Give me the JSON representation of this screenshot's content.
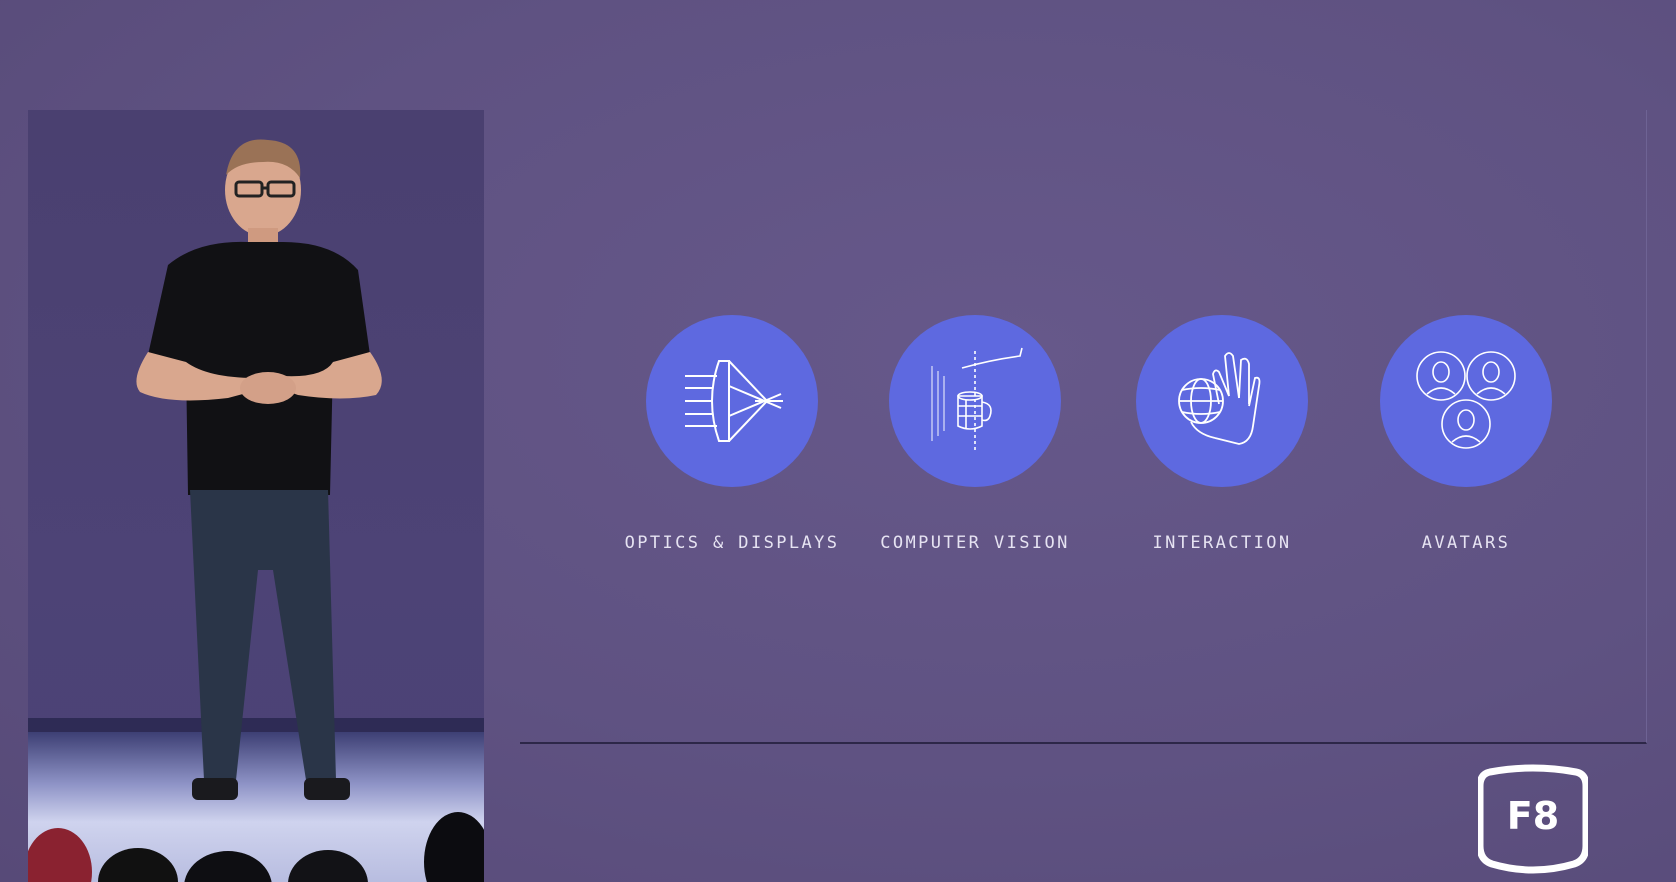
{
  "slide": {
    "features": [
      {
        "label": "OPTICS & DISPLAYS",
        "icon": "lens-optics-icon"
      },
      {
        "label": "COMPUTER VISION",
        "icon": "mug-scan-icon"
      },
      {
        "label": "INTERACTION",
        "icon": "hand-globe-icon"
      },
      {
        "label": "AVATARS",
        "icon": "people-avatars-icon"
      }
    ]
  },
  "badge": {
    "text": "F8"
  },
  "colors": {
    "background": "#5f5282",
    "circle": "#5e69e0",
    "label": "#e6e3f2"
  }
}
